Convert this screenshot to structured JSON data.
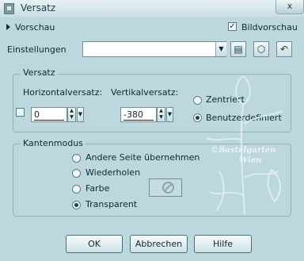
{
  "window": {
    "title": "Versatz",
    "close_label": "x"
  },
  "preview": {
    "label": "Vorschau",
    "show_preview_label": "Bildvorschau",
    "show_preview_checked": true
  },
  "presets": {
    "label": "Einstellungen",
    "value": ""
  },
  "offset": {
    "group_title": "Versatz",
    "horizontal_label": "Horizontalversatz:",
    "horizontal_value": "0",
    "vertical_label": "Vertikalversatz:",
    "vertical_value": "-380",
    "centered_label": "Zentriert",
    "custom_label": "Benutzerdefiniert",
    "selected": "custom"
  },
  "edge_mode": {
    "group_title": "Kantenmodus",
    "options": [
      "Andere Seite übernehmen",
      "Wiederholen",
      "Farbe",
      "Transparent"
    ],
    "selected": "Transparent"
  },
  "watermark": {
    "line1": "©Bastelgarten",
    "line2": "Wien"
  },
  "buttons": {
    "ok": "OK",
    "cancel": "Abbrechen",
    "help": "Hilfe"
  },
  "colors": {
    "dialog_bg": "#bcd8de",
    "text": "#0c2a33"
  }
}
